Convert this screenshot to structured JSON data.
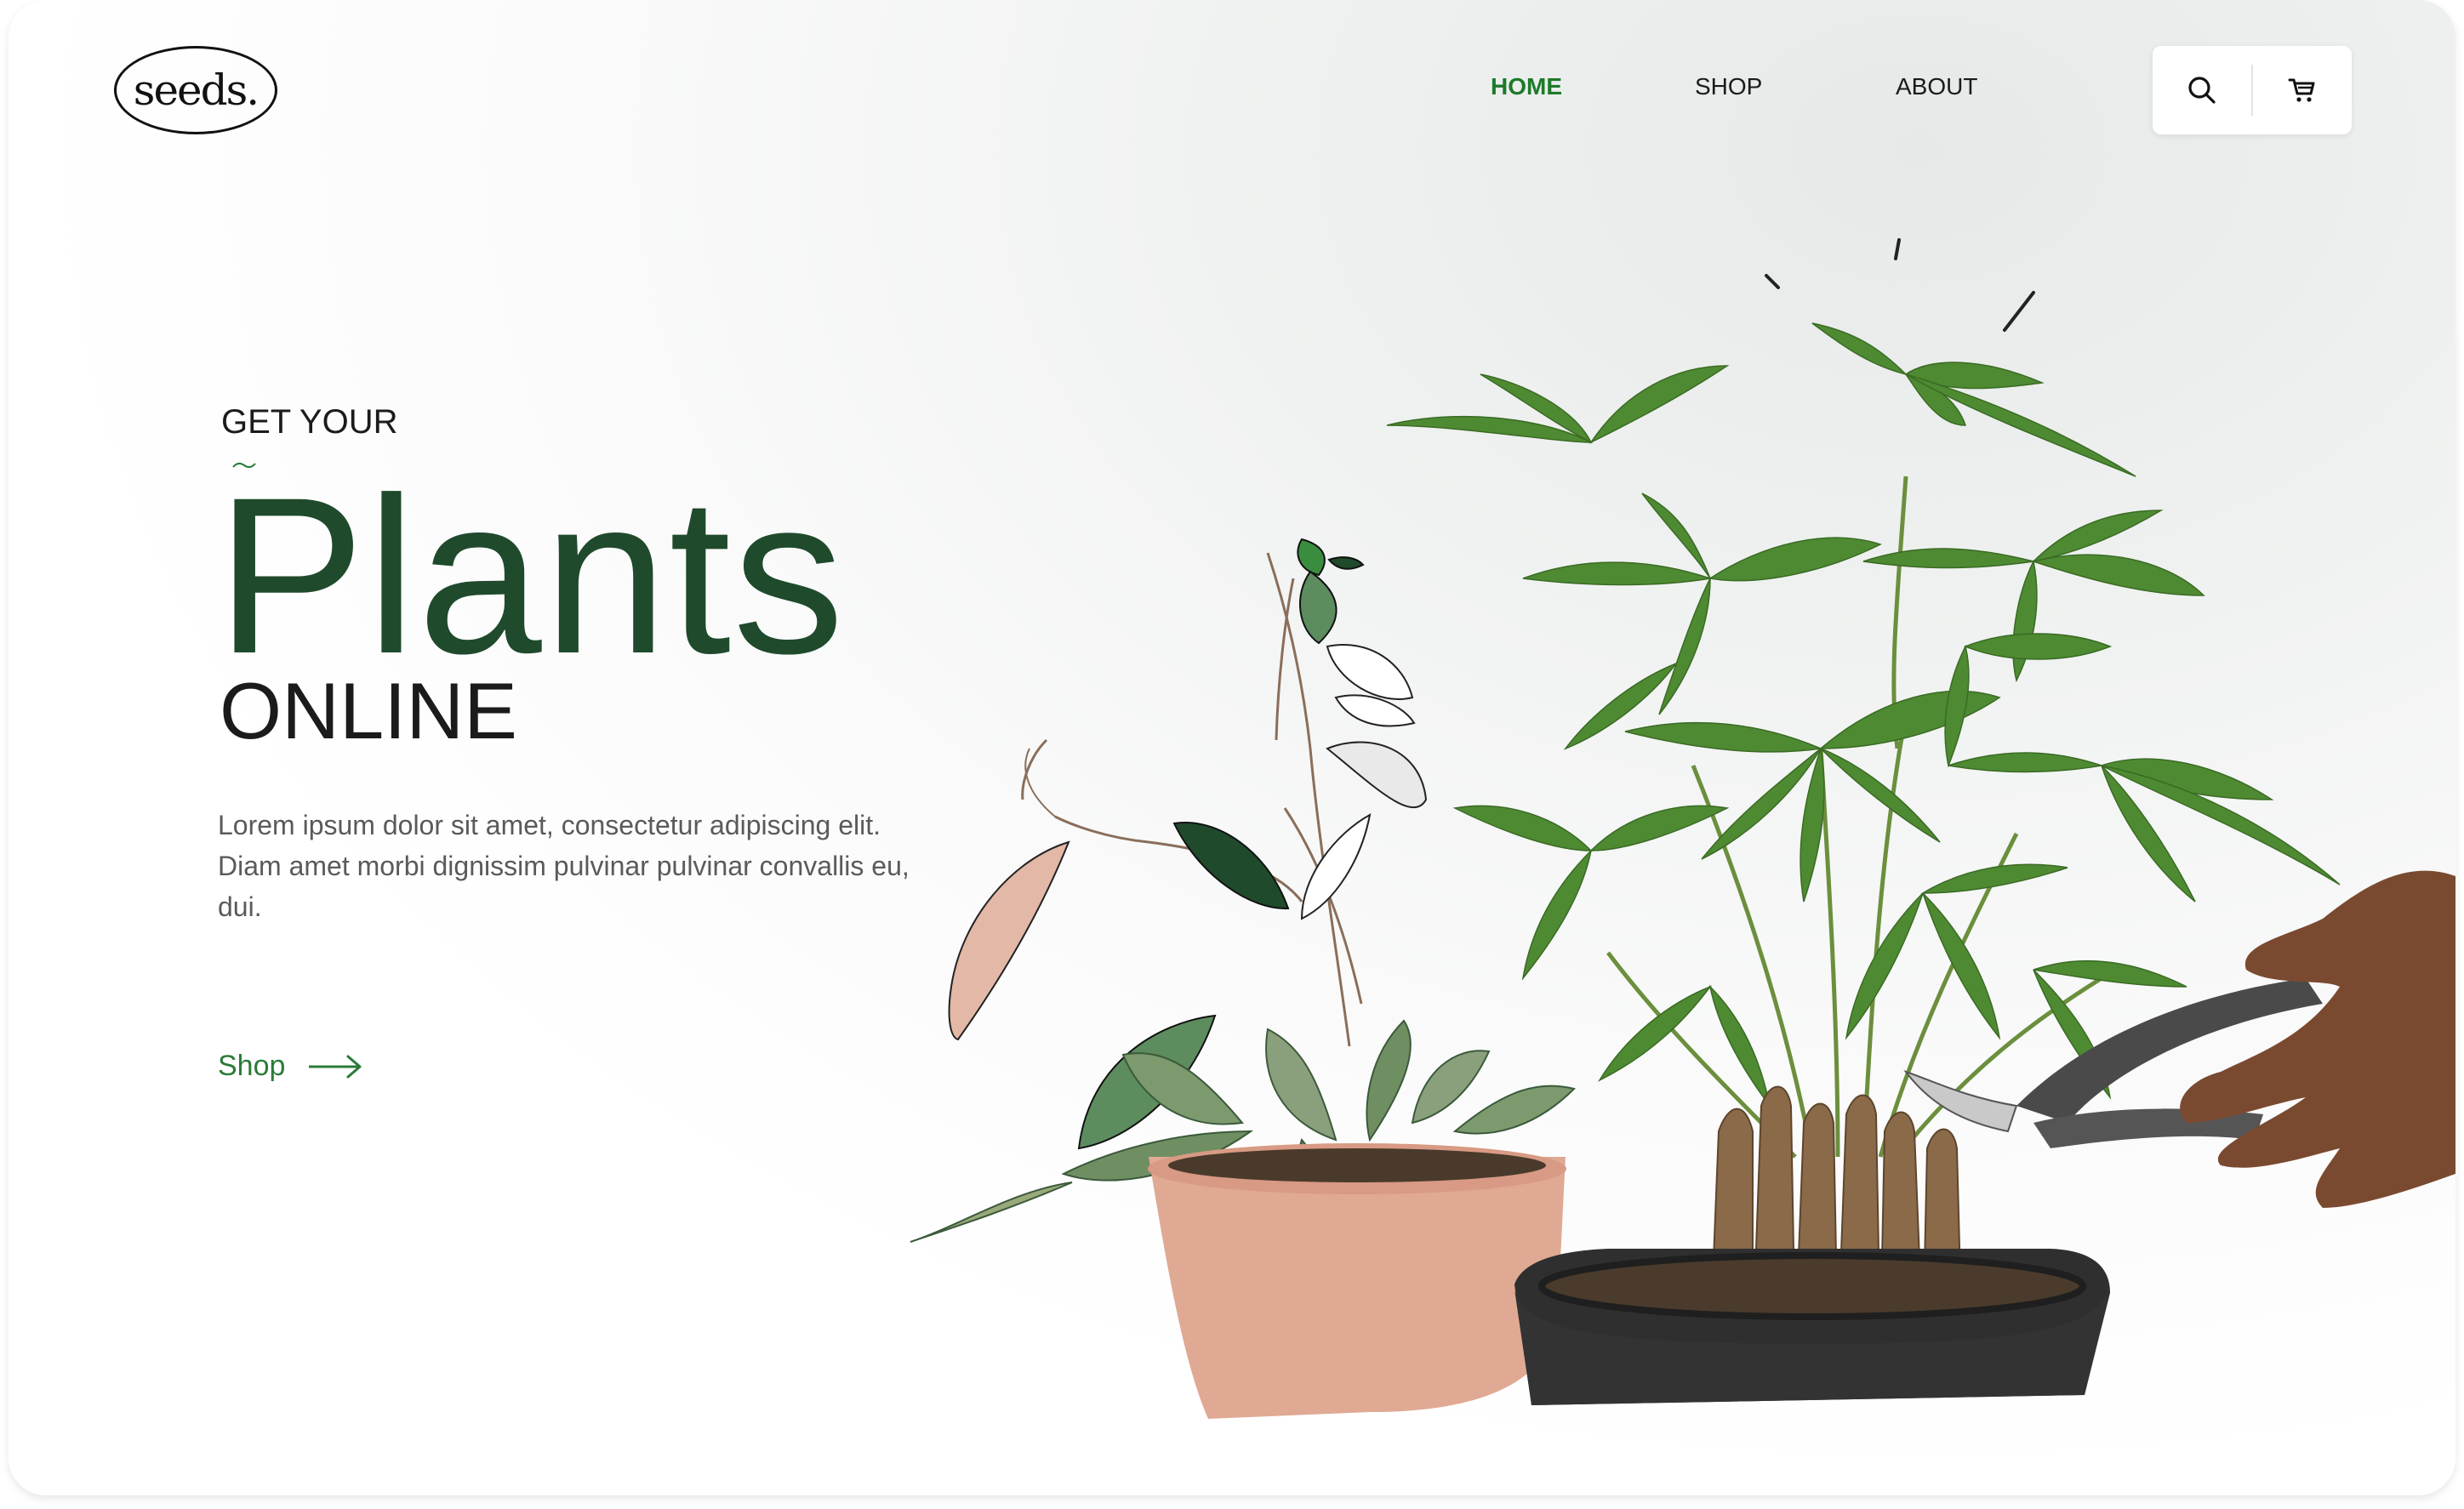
{
  "brand": {
    "logo_text": "seeds."
  },
  "nav": {
    "items": [
      {
        "label": "HOME",
        "active": true
      },
      {
        "label": "SHOP"
      },
      {
        "label": "ABOUT"
      }
    ]
  },
  "toolbar": {
    "search_icon": "search-icon",
    "cart_icon": "cart-icon"
  },
  "hero": {
    "eyebrow": "GET YOUR",
    "title": "Plants",
    "subtitle": "ONLINE",
    "description": "Lorem ipsum dolor sit amet, consectetur adipiscing elit. Diam amet morbi dignissim pulvinar pulvinar convallis eu, dui.",
    "cta_label": "Shop",
    "cta_icon": "arrow-right-icon"
  },
  "colors": {
    "accent": "#1d7a2a",
    "title": "#1f4a2c",
    "text": "#1b1b1b",
    "muted": "#5a5a5a",
    "pot_pink": "#e0a993",
    "pot_black": "#2f2f2f"
  }
}
